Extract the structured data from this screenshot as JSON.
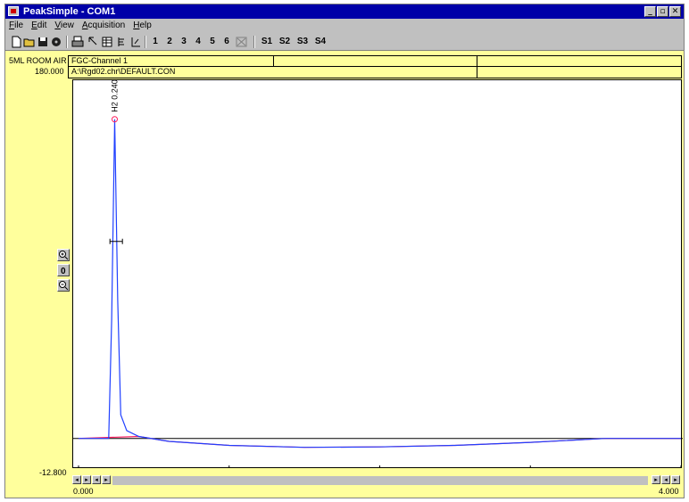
{
  "window": {
    "title": "PeakSimple - COM1"
  },
  "winbuttons": [
    "_",
    "▫",
    "✕"
  ],
  "menu": [
    "File",
    "Edit",
    "View",
    "Acquisition",
    "Help"
  ],
  "toolbar": {
    "channels": [
      "1",
      "2",
      "3",
      "4",
      "5",
      "6"
    ],
    "series_buttons": [
      "S1",
      "S2",
      "S3",
      "S4"
    ]
  },
  "info": {
    "sample_label": "5ML ROOM AIR",
    "channel": "FGC-Channel 1",
    "file": "A:\\Rgd02.chr\\DEFAULT.CON"
  },
  "axes": {
    "y_max_label": "180.000",
    "y_min_label": "-12.800",
    "x_min_label": "0.000",
    "x_max_label": "4.000"
  },
  "peak_label": "H2 0.240",
  "colors": {
    "background": "#ffff9c",
    "trace": "#2040ff",
    "baseline": "#ff2060",
    "titlebar": "#0000a8"
  },
  "chart_data": {
    "type": "line",
    "xlim": [
      0,
      4
    ],
    "ylim": [
      -12.8,
      180
    ],
    "x": [
      0.0,
      0.2,
      0.22,
      0.24,
      0.26,
      0.28,
      0.32,
      0.4,
      0.6,
      1.0,
      1.5,
      2.0,
      2.5,
      3.0,
      3.5,
      4.0
    ],
    "y": [
      0.0,
      0.0,
      60.0,
      162.0,
      70.0,
      12.0,
      4.0,
      1.0,
      -1.5,
      -3.5,
      -4.5,
      -4.3,
      -3.5,
      -2.0,
      0.0,
      0.0
    ],
    "annotations": [
      {
        "text": "H2 0.240",
        "x": 0.24,
        "y": 162.0
      }
    ]
  }
}
